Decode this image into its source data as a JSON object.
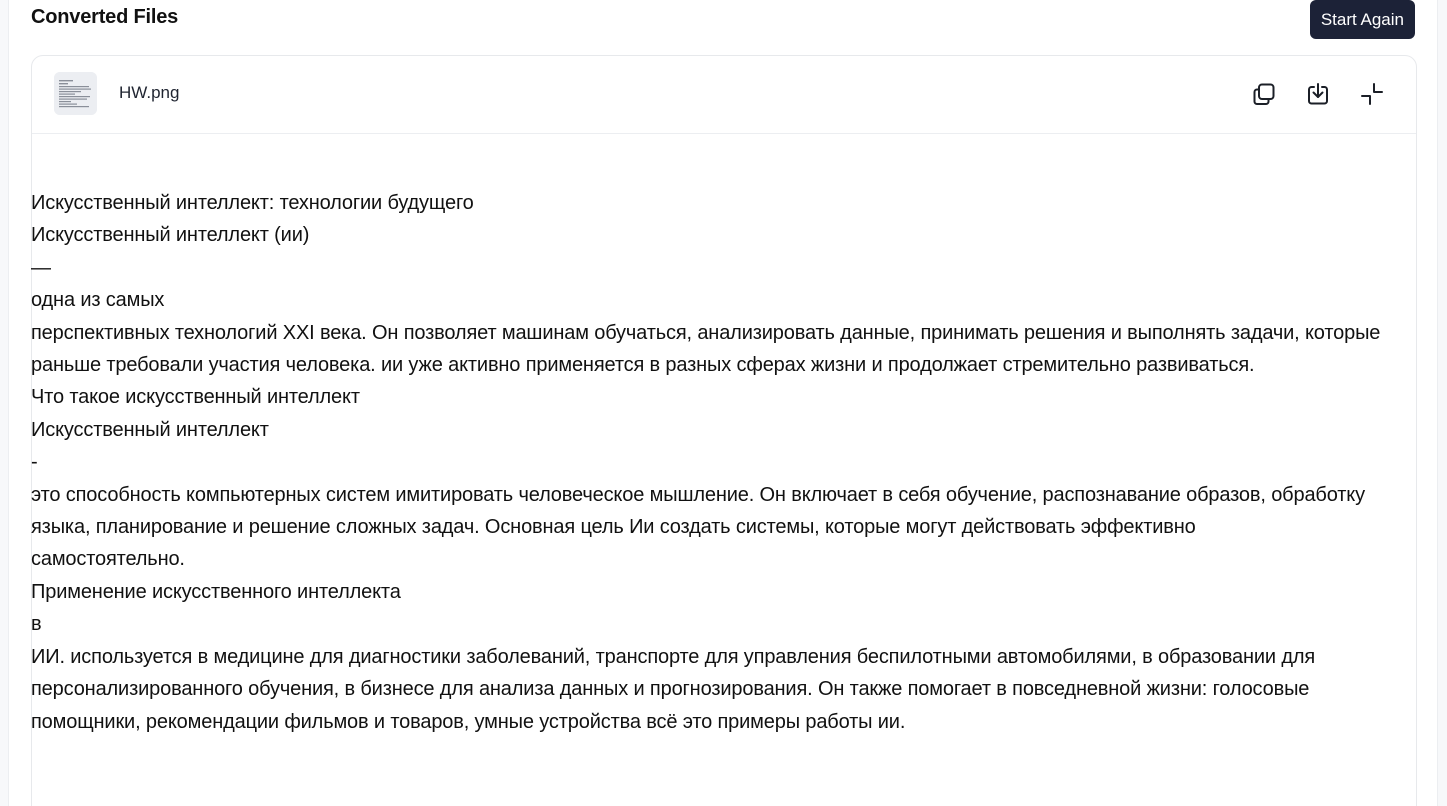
{
  "header": {
    "title": "Converted Files",
    "start_again_label": "Start Again"
  },
  "file": {
    "name": "HW.png",
    "thumbnail_icon": "image-thumbnail",
    "actions": {
      "copy_icon": "copy-icon",
      "download_icon": "download-icon",
      "collapse_icon": "collapse-icon"
    }
  },
  "content": {
    "lines": [
      "Искусственный интеллект: технологии будущего",
      "Искусственный интеллект (ии)",
      "—",
      "одна из самых",
      "перспективных технологий XXI века. Он позволяет машинам обучаться, анализировать данные, принимать решения и выполнять задачи, которые раньше требовали участия человека. ии уже активно применяется в разных сферах жизни и продолжает стремительно развиваться.",
      "Что такое искусственный интеллект",
      "Искусственный интеллект",
      "-",
      "это способность компьютерных систем имитировать человеческое мышление. Он включает в себя обучение, распознавание образов, обработку языка, планирование и решение сложных задач. Основная цель Ии создать системы, которые могут действовать эффективно",
      "самостоятельно.",
      "Применение искусственного интеллекта",
      "в",
      "ИИ. используется в медицине для диагностики заболеваний, транспорте для управления беспилотными автомобилями, в образовании для персонализированного обучения, в бизнесе для анализа данных и прогнозирования. Он также помогает в повседневной жизни: голосовые помощники, рекомендации фильмов и товаров, умные устройства всё это примеры работы ии."
    ]
  },
  "colors": {
    "button_bg": "#1c2237",
    "border": "#e7e9ec"
  }
}
